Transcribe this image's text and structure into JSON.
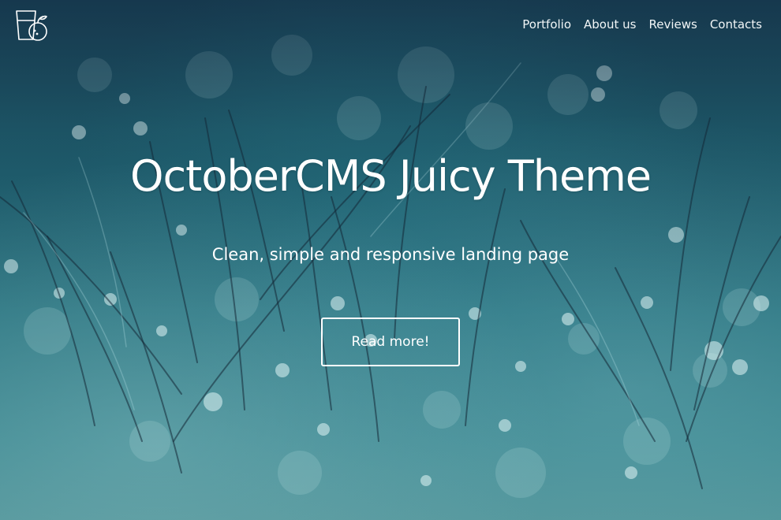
{
  "header": {
    "logo_icon": "juice-glass-icon",
    "nav": [
      {
        "label": "Portfolio"
      },
      {
        "label": "About us"
      },
      {
        "label": "Reviews"
      },
      {
        "label": "Contacts"
      }
    ]
  },
  "hero": {
    "title": "OctoberCMS Juicy Theme",
    "subtitle": "Clean, simple and responsive landing page",
    "cta_label": "Read more!",
    "background_image": "dewy-grass-bokeh",
    "accent_color": "#2a7480"
  }
}
